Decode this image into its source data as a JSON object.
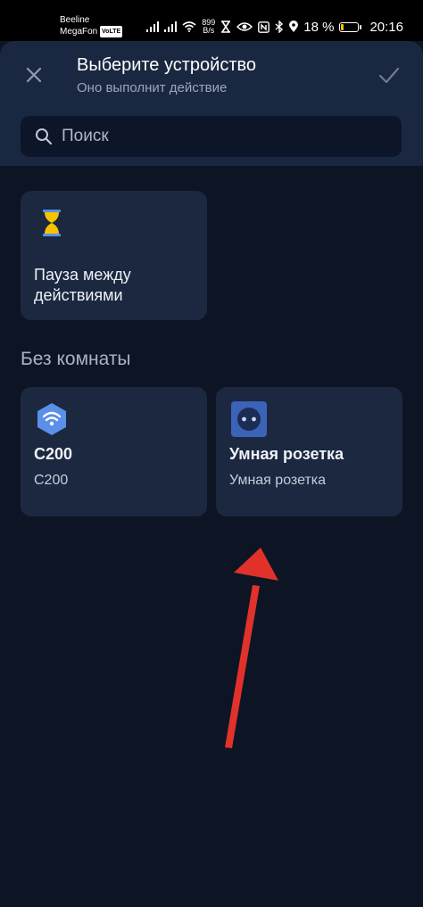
{
  "status_bar": {
    "carrier1": "Beeline",
    "carrier2": "MegaFon",
    "volte": "VoLTE",
    "net_speed_value": "899",
    "net_speed_unit": "B/s",
    "battery_percent": "18 %",
    "battery_level": 0.18,
    "time": "20:16"
  },
  "header": {
    "title": "Выберите устройство",
    "subtitle": "Оно выполнит действие",
    "close_icon": "close-icon",
    "confirm_icon": "check-icon"
  },
  "search": {
    "placeholder": "Поиск",
    "value": ""
  },
  "actions": [
    {
      "name": "Пауза между действиями",
      "icon": "hourglass-icon"
    }
  ],
  "section": {
    "title": "Без комнаты"
  },
  "devices": [
    {
      "name": "C200",
      "model": "C200",
      "icon": "camera-wifi-icon"
    },
    {
      "name": "Умная розетка",
      "model": "Умная розетка",
      "icon": "smart-socket-icon"
    }
  ],
  "colors": {
    "background": "#0d1525",
    "header": "#1a2741",
    "card": "#1c2840",
    "accent_yellow": "#f5c400",
    "icon_blue": "#5b8fe8",
    "annotation_arrow": "#e0312b"
  }
}
